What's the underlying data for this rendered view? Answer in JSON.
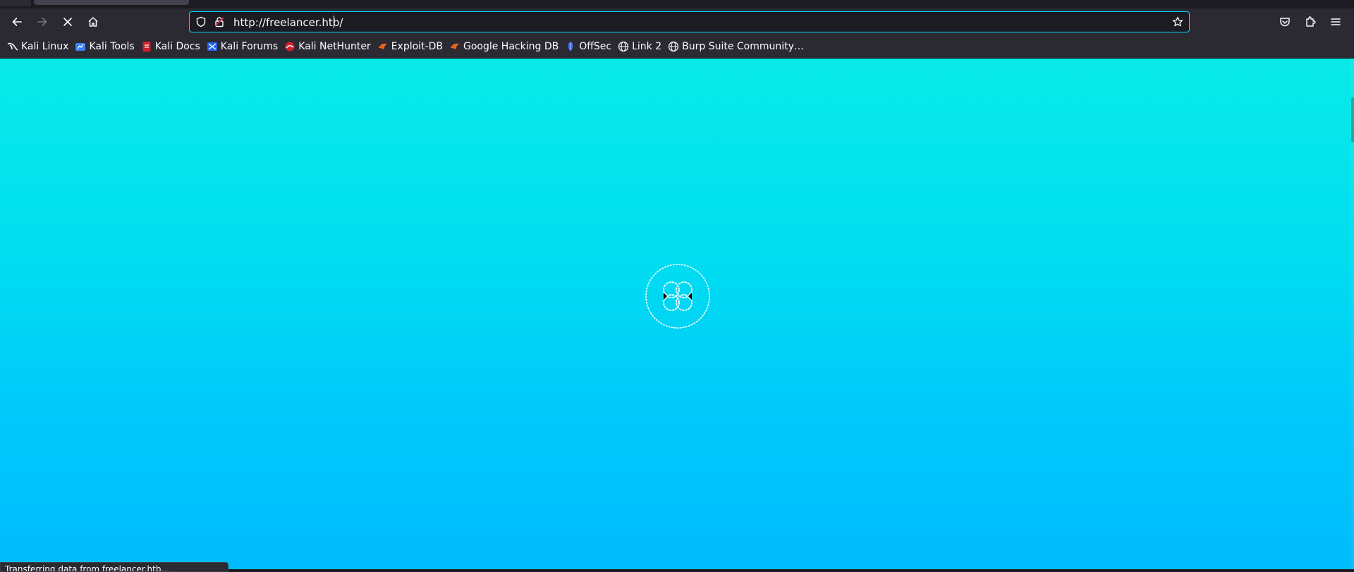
{
  "browser": {
    "url": "http://freelancer.htb/",
    "status_text": "Transferring data from freelancer.htb..."
  },
  "bookmarks": [
    {
      "label": "Kali Linux",
      "icon": "kali-dragon-icon"
    },
    {
      "label": "Kali Tools",
      "icon": "kali-tools-icon"
    },
    {
      "label": "Kali Docs",
      "icon": "kali-docs-icon"
    },
    {
      "label": "Kali Forums",
      "icon": "kali-forums-icon"
    },
    {
      "label": "Kali NetHunter",
      "icon": "nethunter-icon"
    },
    {
      "label": "Exploit-DB",
      "icon": "exploit-db-icon"
    },
    {
      "label": "Google Hacking DB",
      "icon": "ghdb-icon"
    },
    {
      "label": "OffSec",
      "icon": "offsec-icon"
    },
    {
      "label": "Link 2",
      "icon": "globe-icon"
    },
    {
      "label": "Burp Suite Community…",
      "icon": "globe-icon"
    }
  ],
  "colors": {
    "accent": "#00ddff",
    "toolbar": "#2b2a33",
    "page_top": "#08eae8",
    "page_bottom": "#00bcff"
  }
}
